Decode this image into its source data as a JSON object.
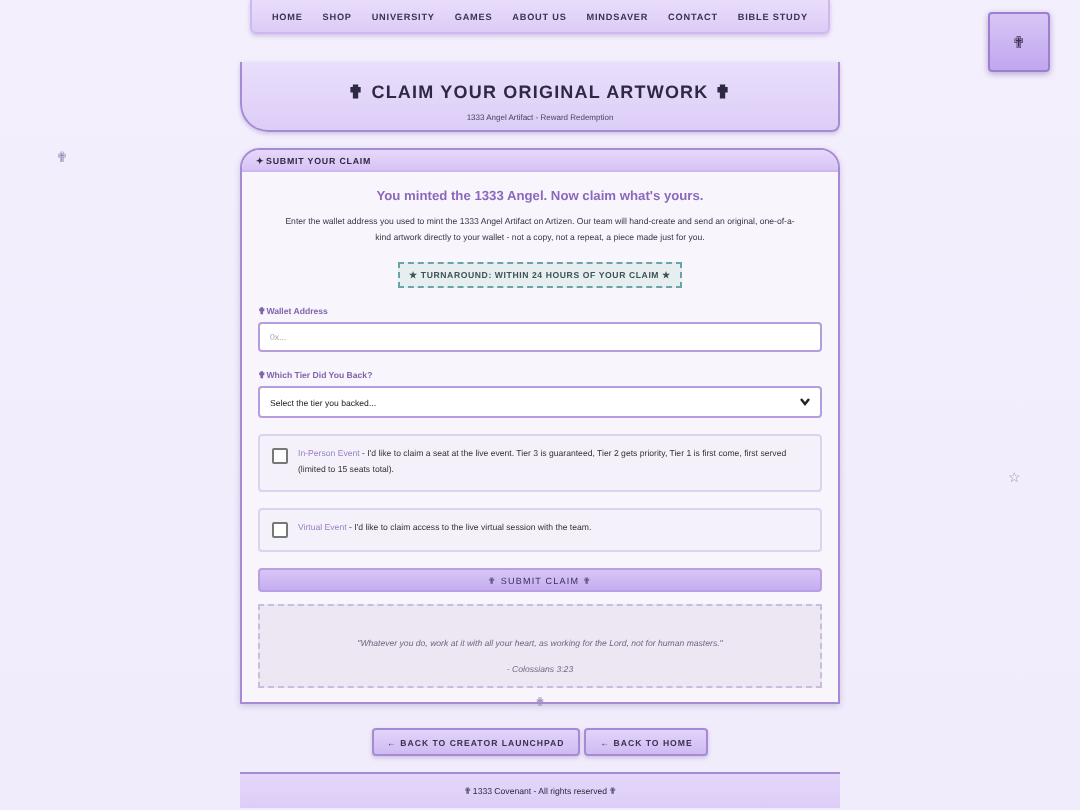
{
  "nav": {
    "items": [
      {
        "label": "HOME"
      },
      {
        "label": "SHOP"
      },
      {
        "label": "UNIVERSITY"
      },
      {
        "label": "GAMES"
      },
      {
        "label": "ABOUT US"
      },
      {
        "label": "MINDSAVER"
      },
      {
        "label": "CONTACT"
      },
      {
        "label": "BIBLE STUDY"
      }
    ]
  },
  "corner_button": {
    "icon": "✟"
  },
  "decorations": [
    {
      "glyph": "✟"
    },
    {
      "glyph": "☆"
    }
  ],
  "header": {
    "title": "✟ CLAIM YOUR ORIGINAL ARTWORK ✟",
    "subtitle": "1333 Angel Artifact - Reward Redemption"
  },
  "claim": {
    "section_title": "✦ SUBMIT YOUR CLAIM",
    "headline": "You minted the 1333 Angel. Now claim what's yours.",
    "intro": "Enter the wallet address you used to mint the 1333 Angel Artifact on Artizen. Our team will hand-create and send an original, one-of-a-kind artwork directly to your wallet - not a copy, not a repeat, a piece made just for you.",
    "turnaround": "★ TURNAROUND: WITHIN 24 HOURS OF YOUR CLAIM ★",
    "wallet": {
      "label": "✟ Wallet Address",
      "placeholder": "0x..."
    },
    "tier": {
      "label": "✟ Which Tier Did You Back?",
      "value": "Select the tier you backed..."
    },
    "options": [
      {
        "name": "In-Person Event",
        "text": " - I'd like to claim a seat at the live event. Tier 3 is guaranteed, Tier 2 gets priority, Tier 1 is first come, first served (limited to 15 seats total).",
        "checked": false
      },
      {
        "name": "Virtual Event",
        "text": " - I'd like to claim access to the live virtual session with the team.",
        "checked": false
      }
    ],
    "submit": "✟ SUBMIT CLAIM ✟",
    "quote": "\"Whatever you do, work at it with all your heart, as working for the Lord, not for human masters.\"",
    "citation": "- Colossians 3:23",
    "divider_mark": "✟"
  },
  "links": [
    {
      "label": "← BACK TO CREATOR LAUNCHPAD"
    },
    {
      "label": "← BACK TO HOME"
    }
  ],
  "footer": "✟ 1333 Covenant - All rights reserved ✟"
}
